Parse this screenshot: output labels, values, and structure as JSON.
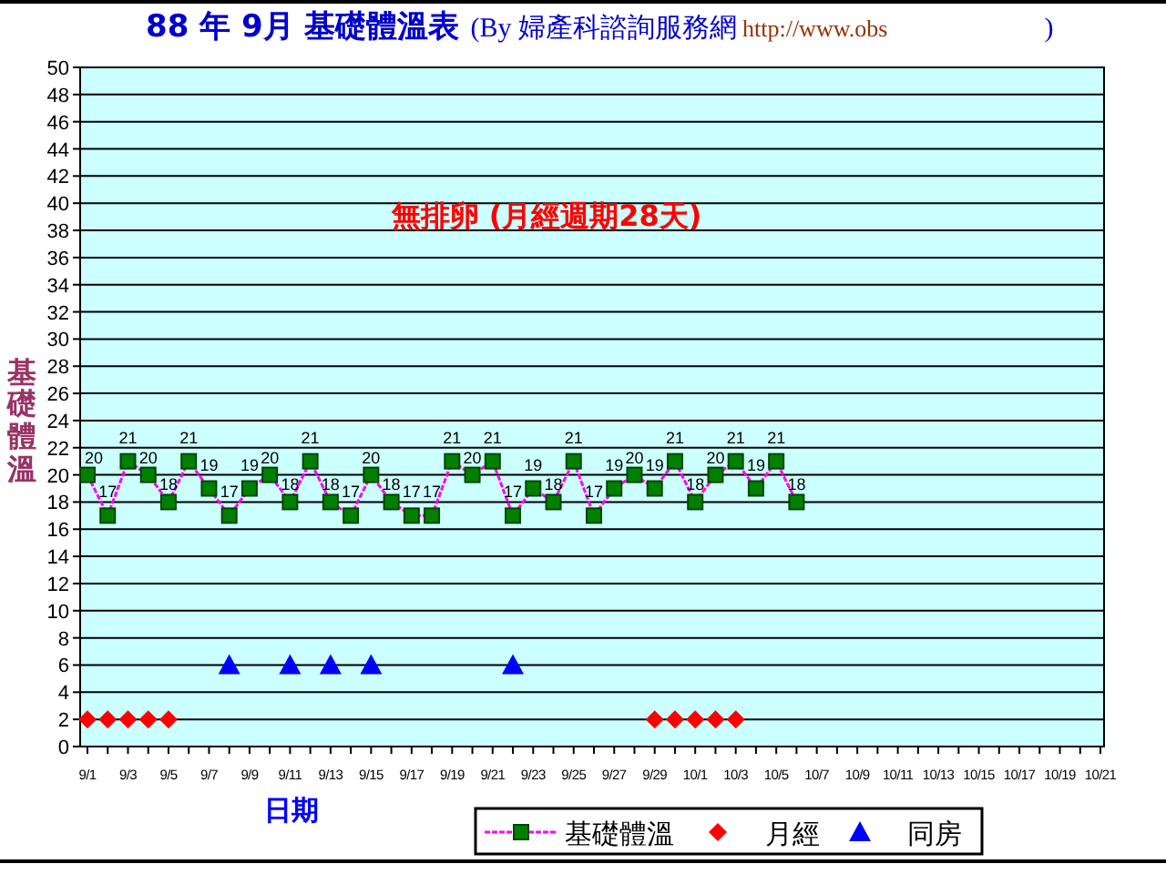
{
  "title": [
    {
      "kind": "heading",
      "text": "88 年 9月 基礎體溫表"
    },
    {
      "kind": "source",
      "text": "(By 婦產科諮詢服務網"
    },
    {
      "kind": "url",
      "text": "http://www.obs"
    },
    {
      "kind": "close",
      "text": ")"
    }
  ],
  "chart": {
    "chart_data": {
      "type": "line",
      "xlabel": "日期",
      "ylabel": "基礎體溫",
      "ylim": [
        0,
        50
      ],
      "grid": true,
      "legend": "bottom",
      "yticks": [
        0,
        2,
        4,
        6,
        8,
        10,
        12,
        14,
        16,
        18,
        20,
        22,
        24,
        26,
        28,
        30,
        32,
        34,
        36,
        38,
        40,
        42,
        44,
        46,
        48,
        50
      ],
      "categories": [
        "9/1",
        null,
        "9/3",
        null,
        "9/5",
        null,
        "9/7",
        null,
        "9/9",
        null,
        "9/11",
        null,
        "9/13",
        null,
        "9/15",
        null,
        "9/17",
        null,
        "9/19",
        null,
        "9/21",
        null,
        "9/23",
        null,
        "9/25",
        null,
        "9/27",
        null,
        "9/29",
        null,
        "10/1",
        null,
        "10/3",
        null,
        "10/5",
        null,
        "10/7",
        null,
        "10/9",
        null,
        "10/11",
        null,
        "10/13",
        null,
        "10/15",
        null,
        "10/17",
        null,
        "10/19",
        null,
        "10/21"
      ],
      "series": [
        {
          "name": "基礎體溫",
          "type": "line",
          "line_style": "dashed",
          "color": "#ff00ff",
          "marker": "square",
          "data_labels": true,
          "values": [
            20,
            17,
            21,
            20,
            18,
            21,
            19,
            17,
            19,
            20,
            18,
            21,
            18,
            17,
            20,
            18,
            17,
            17,
            21,
            20,
            21,
            17,
            19,
            18,
            21,
            17,
            19,
            20,
            19,
            21,
            18,
            20,
            21,
            19,
            21,
            18,
            null,
            null,
            null,
            null,
            null,
            null,
            null,
            null,
            null,
            null,
            null,
            null,
            null,
            null,
            null
          ]
        },
        {
          "name": "月經",
          "type": "scatter",
          "color": "#ff0000",
          "marker": "diamond",
          "data_labels": false,
          "values": [
            2,
            2,
            2,
            2,
            2,
            null,
            null,
            null,
            null,
            null,
            null,
            null,
            null,
            null,
            null,
            null,
            null,
            null,
            null,
            null,
            null,
            null,
            null,
            null,
            null,
            null,
            null,
            null,
            2,
            2,
            2,
            2,
            2,
            null,
            null,
            null,
            null,
            null,
            null,
            null,
            null,
            null,
            null,
            null,
            null,
            null,
            null,
            null,
            null,
            null,
            null
          ]
        },
        {
          "name": "同房",
          "type": "scatter",
          "color": "#0000ff",
          "marker": "triangle",
          "data_labels": false,
          "values": [
            null,
            null,
            null,
            null,
            null,
            null,
            null,
            6,
            null,
            null,
            6,
            null,
            6,
            null,
            6,
            null,
            null,
            null,
            null,
            null,
            null,
            6,
            null,
            null,
            null,
            null,
            null,
            null,
            null,
            null,
            null,
            null,
            null,
            null,
            null,
            null,
            null,
            null,
            null,
            null,
            null,
            null,
            null,
            null,
            null,
            null,
            null,
            null,
            null,
            null,
            null
          ]
        }
      ],
      "annotations": [
        "無排卵 (月經週期28天)"
      ]
    }
  }
}
